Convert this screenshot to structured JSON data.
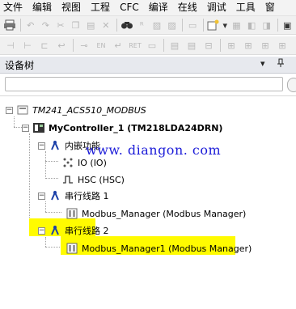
{
  "menu": [
    "文件",
    "编辑",
    "视图",
    "工程",
    "CFC",
    "编译",
    "在线",
    "调试",
    "工具",
    "窗"
  ],
  "pane": {
    "title": "设备树",
    "dropdown_glyph": "▾",
    "pin_glyph": "ᵩ"
  },
  "search": {
    "placeholder": ""
  },
  "tree": {
    "project": "TM241_ACS510_MODBUS",
    "controller": "MyController_1 (TM218LDA24DRN)",
    "embedded": "内嵌功能",
    "io": "IO (IO)",
    "hsc": "HSC (HSC)",
    "serial1": "串行线路 1",
    "modbus1": "Modbus_Manager (Modbus Manager)",
    "serial2": "串行线路 2",
    "modbus2": "Modbus_Manager1 (Modbus Manager)"
  },
  "watermark": "www. diangon. com",
  "colors": {
    "highlight": "#fffb00",
    "watermark": "#1b1bd8"
  }
}
